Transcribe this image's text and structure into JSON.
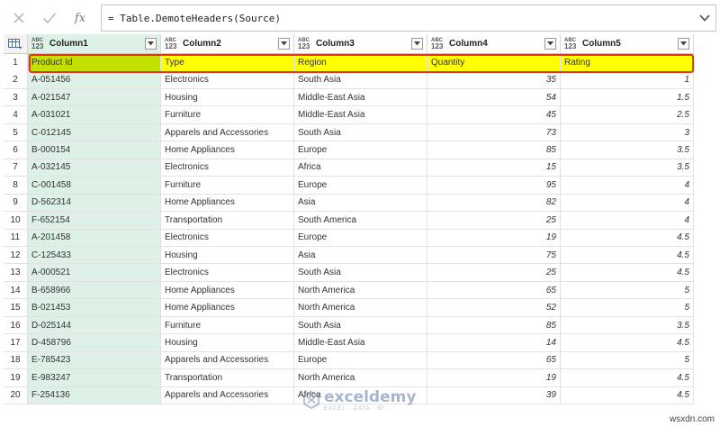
{
  "formula_bar": {
    "cancel_icon": "close-icon",
    "confirm_icon": "check-icon",
    "fx_label": "fx",
    "formula": "= Table.DemoteHeaders(Source)"
  },
  "grid": {
    "type_icon_top": "ABC",
    "type_icon_bottom": "123",
    "columns": [
      "Column1",
      "Column2",
      "Column3",
      "Column4",
      "Column5"
    ],
    "rows": [
      [
        "Product Id",
        "Type",
        "Region",
        "Quantity",
        "Rating"
      ],
      [
        "A-051456",
        "Electronics",
        "South Asia",
        "35",
        "1"
      ],
      [
        "A-021547",
        "Housing",
        "Middle-East Asia",
        "54",
        "1.5"
      ],
      [
        "A-031021",
        "Furniture",
        "Middle-East Asia",
        "45",
        "2.5"
      ],
      [
        "C-012145",
        "Apparels and Accessories",
        "South Asia",
        "73",
        "3"
      ],
      [
        "B-000154",
        "Home Appliances",
        "Europe",
        "85",
        "3.5"
      ],
      [
        "A-032145",
        "Electronics",
        "Africa",
        "15",
        "3.5"
      ],
      [
        "C-001458",
        "Furniture",
        "Europe",
        "95",
        "4"
      ],
      [
        "D-562314",
        "Home Appliances",
        "Asia",
        "82",
        "4"
      ],
      [
        "F-652154",
        "Transportation",
        "South America",
        "25",
        "4"
      ],
      [
        "A-201458",
        "Electronics",
        "Europe",
        "19",
        "4.5"
      ],
      [
        "C-125433",
        "Housing",
        "Asia",
        "75",
        "4.5"
      ],
      [
        "A-000521",
        "Electronics",
        "South Asia",
        "25",
        "4.5"
      ],
      [
        "B-658966",
        "Home Appliances",
        "North America",
        "65",
        "5"
      ],
      [
        "B-021453",
        "Home Appliances",
        "North America",
        "52",
        "5"
      ],
      [
        "D-025144",
        "Furniture",
        "South Asia",
        "85",
        "3.5"
      ],
      [
        "D-458796",
        "Housing",
        "Middle-East Asia",
        "14",
        "4.5"
      ],
      [
        "E-785423",
        "Apparels and Accessories",
        "Europe",
        "65",
        "5"
      ],
      [
        "E-983247",
        "Transportation",
        "North America",
        "19",
        "4.5"
      ],
      [
        "F-254136",
        "Apparels and Accessories",
        "Africa",
        "39",
        "4.5"
      ]
    ]
  },
  "watermark": {
    "name": "exceldemy",
    "tagline": "EXCEL · DATA · BI"
  },
  "site_label": "wsxdn.com",
  "colors": {
    "highlight_row": "#ffff00",
    "highlight_border": "#e0342a",
    "column1_fill": "#ddf1e6"
  }
}
